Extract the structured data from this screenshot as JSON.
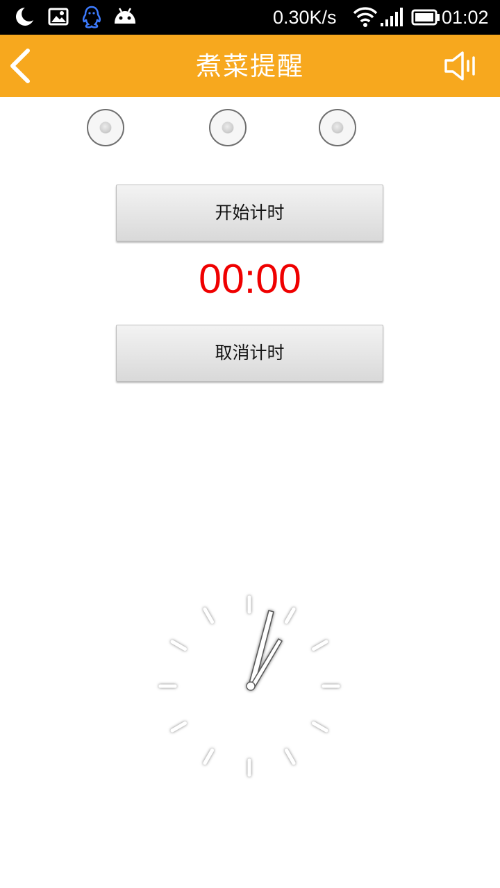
{
  "status_bar": {
    "net_speed": "0.30K/s",
    "time": "01:02",
    "icons": [
      "moon-icon",
      "image-icon",
      "qq-icon",
      "android-icon",
      "wifi-icon",
      "signal-icon",
      "battery-icon"
    ]
  },
  "app_bar": {
    "title": "煮菜提醒",
    "background_color": "#f7a81e",
    "icons": [
      "back-arrow-icon",
      "speaker-icon"
    ]
  },
  "radio_options": [
    {
      "selected": false
    },
    {
      "selected": false
    },
    {
      "selected": false
    }
  ],
  "buttons": {
    "start_label": "开始计时",
    "cancel_label": "取消计时"
  },
  "timer": {
    "display": "00:00",
    "color": "#ef0000"
  }
}
